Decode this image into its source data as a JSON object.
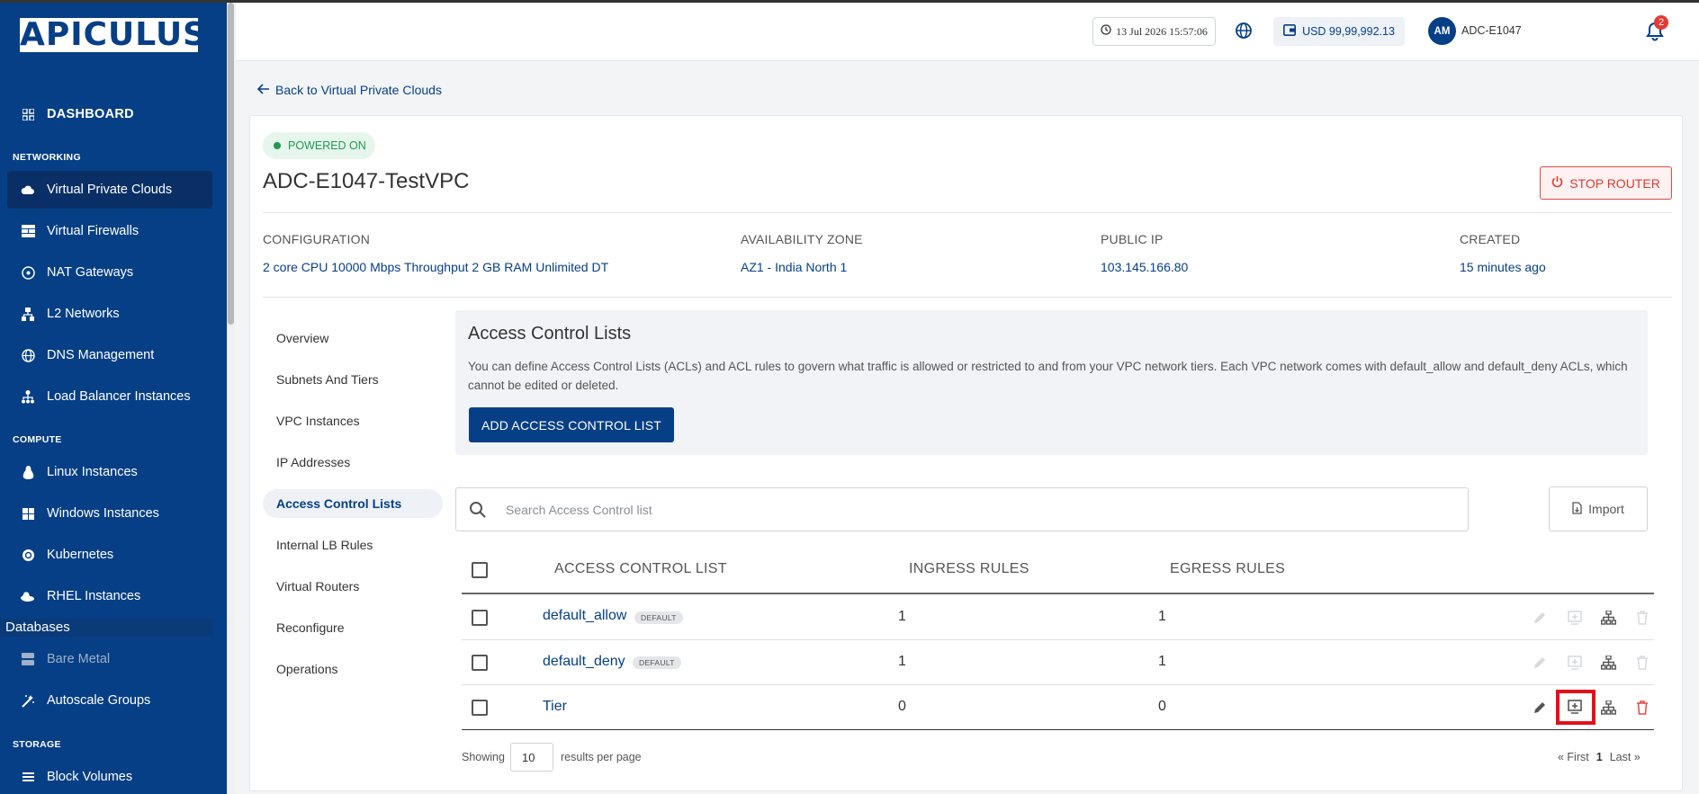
{
  "app": {
    "logo": "APICULUS"
  },
  "sidebar": {
    "dashboard": "DASHBOARD",
    "sections": {
      "networking": "NETWORKING",
      "compute": "COMPUTE",
      "databases": "Databases",
      "storage": "STORAGE"
    },
    "networking": [
      {
        "label": "Virtual Private Clouds",
        "icon": "cloud-icon",
        "active": true
      },
      {
        "label": "Virtual Firewalls",
        "icon": "firewall-icon"
      },
      {
        "label": "NAT Gateways",
        "icon": "nat-icon"
      },
      {
        "label": "L2 Networks",
        "icon": "network-icon"
      },
      {
        "label": "DNS Management",
        "icon": "globe-icon"
      },
      {
        "label": "Load Balancer Instances",
        "icon": "load-balancer-icon"
      }
    ],
    "compute": [
      {
        "label": "Linux Instances",
        "icon": "linux-icon"
      },
      {
        "label": "Windows Instances",
        "icon": "windows-icon"
      },
      {
        "label": "Kubernetes",
        "icon": "kubernetes-icon"
      },
      {
        "label": "RHEL Instances",
        "icon": "rhel-icon"
      }
    ],
    "bare_metal": "Bare Metal",
    "autoscale": "Autoscale Groups",
    "storage": [
      {
        "label": "Block Volumes",
        "icon": "volumes-icon"
      }
    ]
  },
  "header": {
    "datetime": "13 Jul 2026 15:57:06",
    "balance": "USD 99,99,992.13",
    "avatar_initials": "AM",
    "username": "ADC-E1047",
    "notification_count": "2"
  },
  "page": {
    "back_link": "Back to Virtual Private Clouds",
    "status": "POWERED ON",
    "vpc_name": "ADC-E1047-TestVPC",
    "stop_button": "STOP ROUTER",
    "info": {
      "configuration_label": "CONFIGURATION",
      "configuration_value": "2 core CPU 10000 Mbps Throughput 2 GB RAM Unlimited DT",
      "zone_label": "AVAILABILITY ZONE",
      "zone_value": "AZ1 - India North 1",
      "ip_label": "PUBLIC IP",
      "ip_value": "103.145.166.80",
      "created_label": "CREATED",
      "created_value": "15 minutes ago"
    },
    "tabs": [
      {
        "label": "Overview"
      },
      {
        "label": "Subnets And Tiers"
      },
      {
        "label": "VPC Instances"
      },
      {
        "label": "IP Addresses"
      },
      {
        "label": "Access Control Lists",
        "active": true
      },
      {
        "label": "Internal LB Rules"
      },
      {
        "label": "Virtual Routers"
      },
      {
        "label": "Reconfigure"
      },
      {
        "label": "Operations"
      }
    ]
  },
  "acl": {
    "title": "Access Control Lists",
    "description": "You can define Access Control Lists (ACLs) and ACL rules to govern what traffic is allowed or restricted to and from your VPC network tiers. Each VPC network comes with default_allow and default_deny ACLs, which cannot be edited or deleted.",
    "add_button": "ADD ACCESS CONTROL LIST",
    "search_placeholder": "Search Access Control list",
    "import_button": "Import",
    "columns": {
      "name": "ACCESS CONTROL LIST",
      "ingress": "INGRESS RULES",
      "egress": "EGRESS RULES"
    },
    "default_tag": "DEFAULT",
    "rows": [
      {
        "name": "default_allow",
        "ingress": "1",
        "egress": "1",
        "is_default": true
      },
      {
        "name": "default_deny",
        "ingress": "1",
        "egress": "1",
        "is_default": true
      },
      {
        "name": "Tier",
        "ingress": "0",
        "egress": "0",
        "is_default": false
      }
    ],
    "pagination": {
      "showing": "Showing",
      "per_page": "10",
      "per_page_label": "results per page",
      "first": "« First",
      "page": "1",
      "last": "Last »"
    }
  },
  "colors": {
    "sidebar": "#063f85",
    "accent": "#063f85",
    "danger": "#e24b43",
    "success": "#1d9a50",
    "highlight": "#e3101b"
  }
}
